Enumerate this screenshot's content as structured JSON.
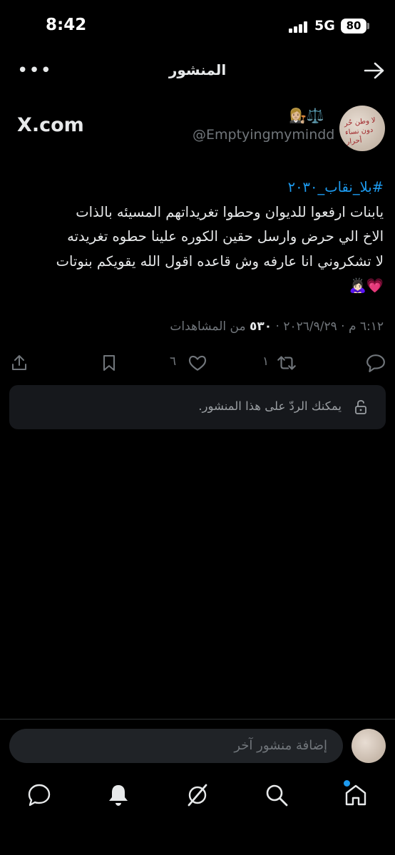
{
  "status_bar": {
    "time": "8:42",
    "network": "5G",
    "battery": "80"
  },
  "header": {
    "title": "المنشور",
    "more_label": "•••"
  },
  "author": {
    "handle": "@Emptyingmymindd",
    "emojis": "👩🏼‍⚖️⚖️",
    "watermark": "X.com"
  },
  "tweet": {
    "hashtag": "#بلا_نقاب_٢٠٣٠",
    "line1": "يابنات ارفعوا للديوان وحطوا تغريداتهم المسيئه بالذات",
    "line2": "الاخ الي حرض وارسل حقين الكوره علينا حطوه تغريدته",
    "line3": "لا تشكروني انا عارفه وش قاعده اقول الله يقويكم بنوتات",
    "emoji_end": "💗🙇🏻‍♀️"
  },
  "meta": {
    "time": "٦:١٢ م",
    "separator": "·",
    "date": "٢٠٢٦/٩/٢٩",
    "views_count": "٥٣٠",
    "views_label": "من المشاهدات"
  },
  "actions": {
    "reposts": "١",
    "likes": "٦"
  },
  "reply_restriction": {
    "text": "يمكنك الردّ على هذا المنشور."
  },
  "compose": {
    "placeholder": "إضافة منشور آخر"
  },
  "colors": {
    "accent": "#1d9bf0",
    "background": "#000000",
    "secondary_text": "#71767b",
    "heart": "#f91880"
  }
}
